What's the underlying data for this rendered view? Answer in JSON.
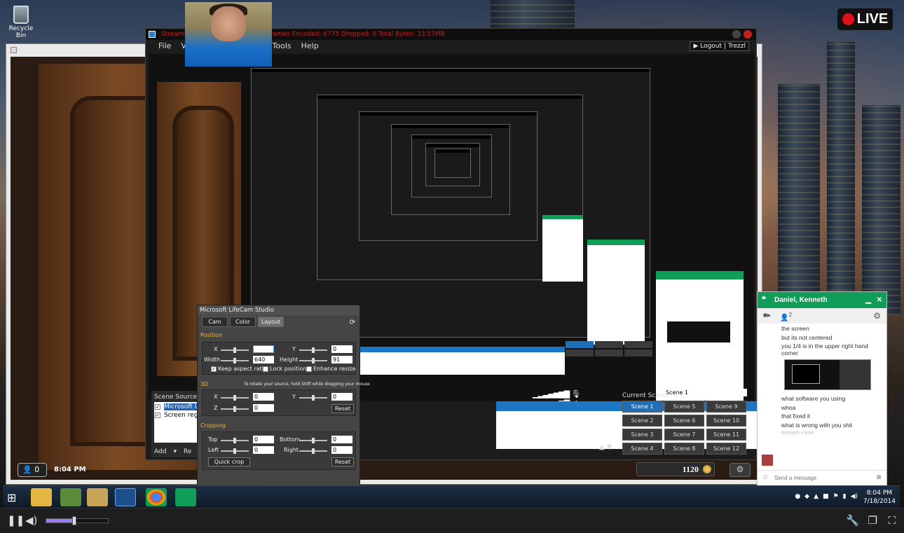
{
  "live_badge": "LIVE",
  "desktop": {
    "recycle_bin": "Recycle Bin",
    "clock_small": "8:04 PM",
    "viewer_count": "0"
  },
  "obs": {
    "title": "Streaming - Bitrate 1051.00Kbps  Frames Encoded: 6775  Dropped: 0  Total Bytes: 33.57MB",
    "menu": [
      "File",
      "View",
      "Tools",
      "Help"
    ],
    "logout": "Logout",
    "user": "Trezzl",
    "sources_label": "Scene Sources:",
    "sources": [
      {
        "label": "Microsoft LifeCam",
        "checked": true,
        "selected": true
      },
      {
        "label": "Screen region",
        "checked": true,
        "selected": false
      }
    ],
    "add_label": "Add",
    "remove_label": "Re",
    "current_scene_label": "Current Scene:",
    "current_scene_value": "Scene 1",
    "scenes": [
      "Scene 1",
      "Scene 5",
      "Scene 9",
      "Scene 2",
      "Scene 6",
      "Scene 10",
      "Scene 3",
      "Scene 7",
      "Scene 11",
      "Scene 4",
      "Scene 8",
      "Scene 12"
    ],
    "active_scene": "Scene 1",
    "coin_count": "1120"
  },
  "lifecam": {
    "title": "Microsoft LifeCam Studio",
    "tabs": [
      "Cam",
      "Color",
      "Layout"
    ],
    "active_tab": "Layout",
    "position_label": "Position",
    "x_label": "X",
    "x_value": "",
    "y_label": "Y",
    "y_value": "0",
    "width_label": "Width",
    "width_value": "640",
    "height_label": "Height",
    "height_value": "91",
    "keep_aspect": "Keep aspect ratio",
    "lock_position": "Lock position",
    "enhance_resize": "Enhance resize",
    "section_3d": "3D",
    "hint_3d": "To rotate your source, hold Shift while dragging your mouse",
    "x3d_value": "0",
    "y3d_value": "0",
    "z_label": "Z",
    "z_value": "0",
    "reset_label": "Reset",
    "cropping_label": "Cropping",
    "top_label": "Top",
    "top_value": "0",
    "bottom_label": "Bottom",
    "bottom_value": "0",
    "left_label": "Left",
    "left_value": "0",
    "right_label": "Right",
    "right_value": "0",
    "quick_crop": "Quick crop",
    "reset_crop": "Reset"
  },
  "chat": {
    "name": "Daniel, Kenneth",
    "participants": "2",
    "messages": [
      "the screen",
      "but its not centered",
      "you 1/4 is in the upper right hand corner",
      "what software you using",
      "whoa",
      "that fixed it",
      "what is wrong with you shit"
    ],
    "status": "Kenneth • Now",
    "placeholder": "Send a message"
  },
  "taskbar": {
    "time": "8:04 PM",
    "date": "7/18/2014"
  },
  "player": {
    "volume_level": 0.45
  },
  "colors": {
    "live_red": "#e0101b",
    "chat_green": "#0f9d58",
    "scene_active": "#1e6fb8",
    "volume_fill": "#9d7cf4"
  }
}
